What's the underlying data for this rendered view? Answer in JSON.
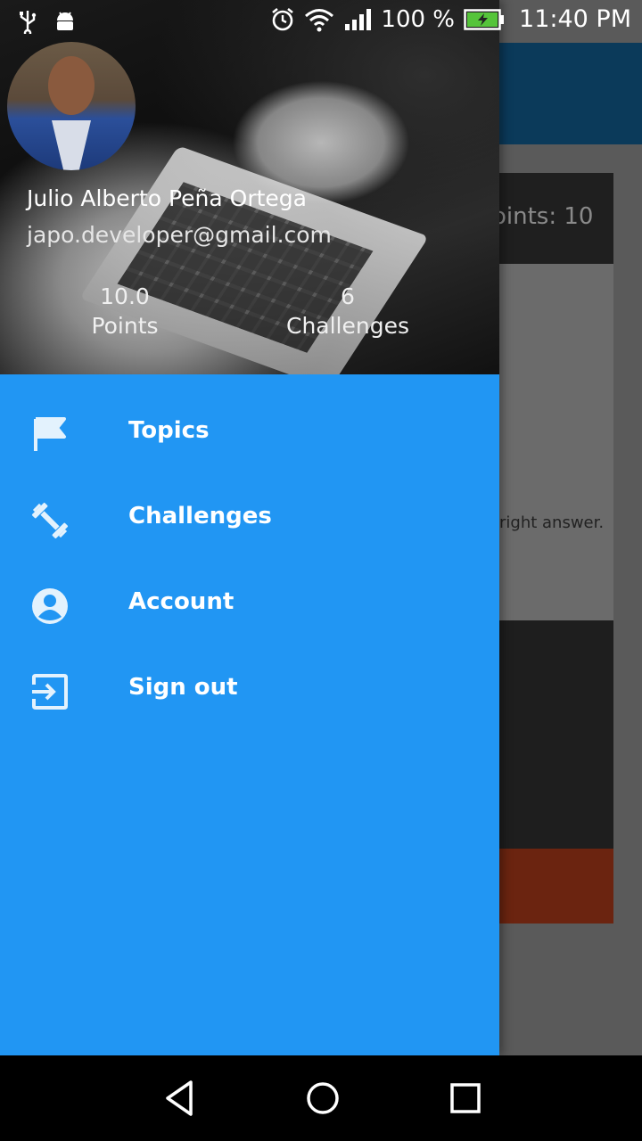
{
  "status_bar": {
    "battery_percent": "100 %",
    "time": "11:40 PM",
    "icons": [
      "usb-icon",
      "android-debug-icon",
      "alarm-icon",
      "wifi-icon",
      "signal-icon",
      "battery-charging-icon"
    ]
  },
  "background": {
    "points_partial": "oints: 10",
    "answer_partial": "right answer."
  },
  "drawer": {
    "user": {
      "name": "Julio Alberto Peña Ortega",
      "email": "japo.developer@gmail.com"
    },
    "stats": {
      "points_value": "10.0",
      "points_label": "Points",
      "challenges_value": "6",
      "challenges_label": "Challenges"
    },
    "menu": [
      {
        "label": "Topics",
        "icon": "flag-icon"
      },
      {
        "label": "Challenges",
        "icon": "dumbbell-icon"
      },
      {
        "label": "Account",
        "icon": "account-circle-icon"
      },
      {
        "label": "Sign out",
        "icon": "exit-icon"
      }
    ],
    "accent_color": "#2196f3"
  },
  "nav_bar": {
    "buttons": [
      "back-icon",
      "home-icon",
      "recent-apps-icon"
    ]
  }
}
